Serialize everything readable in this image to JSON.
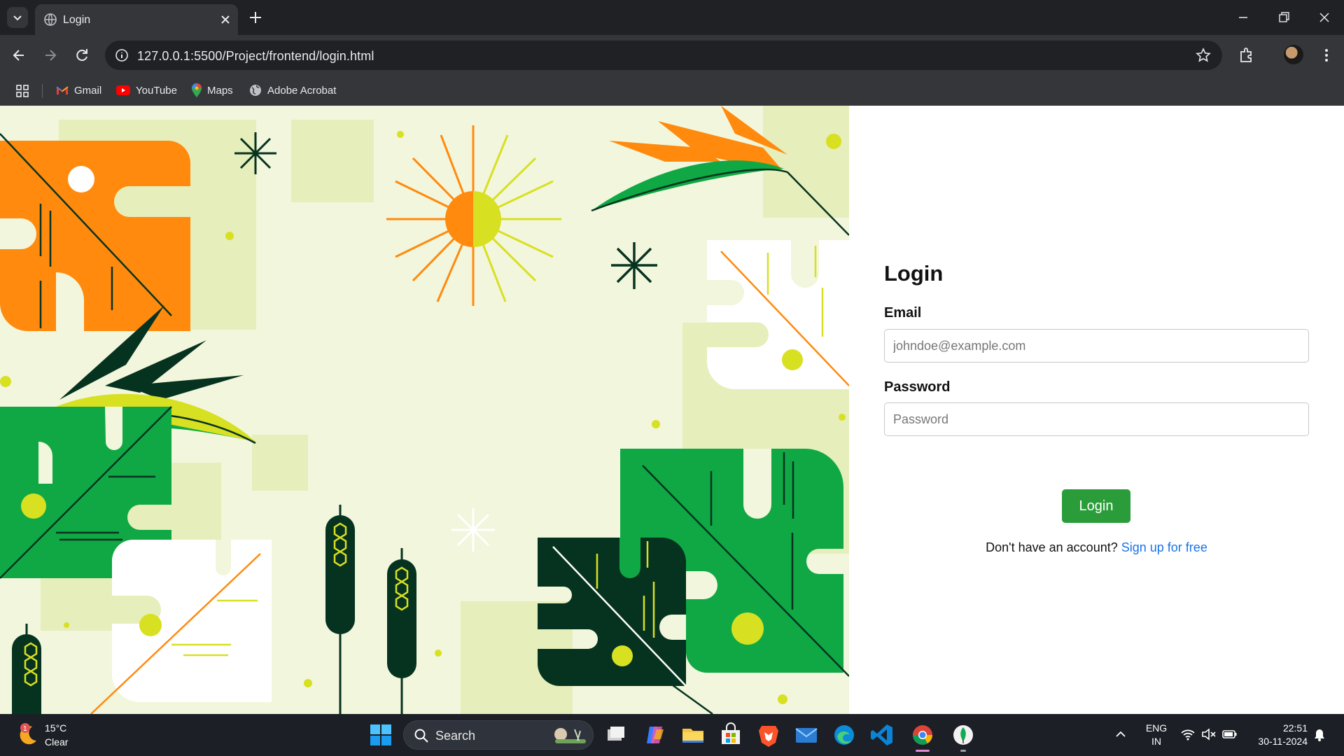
{
  "browser": {
    "tab_title": "Login",
    "url": "127.0.0.1:5500/Project/frontend/login.html",
    "bookmarks": [
      {
        "label": "Gmail",
        "icon": "gmail-icon"
      },
      {
        "label": "YouTube",
        "icon": "youtube-icon"
      },
      {
        "label": "Maps",
        "icon": "maps-icon"
      },
      {
        "label": "Adobe Acrobat",
        "icon": "globe-icon"
      }
    ]
  },
  "login": {
    "title": "Login",
    "email_label": "Email",
    "email_placeholder": "johndoe@example.com",
    "email_value": "",
    "password_label": "Password",
    "password_placeholder": "Password",
    "password_value": "",
    "submit_label": "Login",
    "signup_prompt": "Don't have an account?",
    "signup_link": "Sign up for free"
  },
  "taskbar": {
    "weather_temp": "15°C",
    "weather_condition": "Clear",
    "weather_badge": "1",
    "search_label": "Search",
    "lang_line1": "ENG",
    "lang_line2": "IN",
    "time": "22:51",
    "date": "30-11-2024"
  },
  "colors": {
    "accent_green": "#2a9d3a",
    "link_blue": "#1a73e8",
    "art_orange": "#ff8a0d",
    "art_green": "#0fa844",
    "art_dark_green": "#063320",
    "art_lime": "#d8e022",
    "art_bg": "#f2f6dc"
  }
}
